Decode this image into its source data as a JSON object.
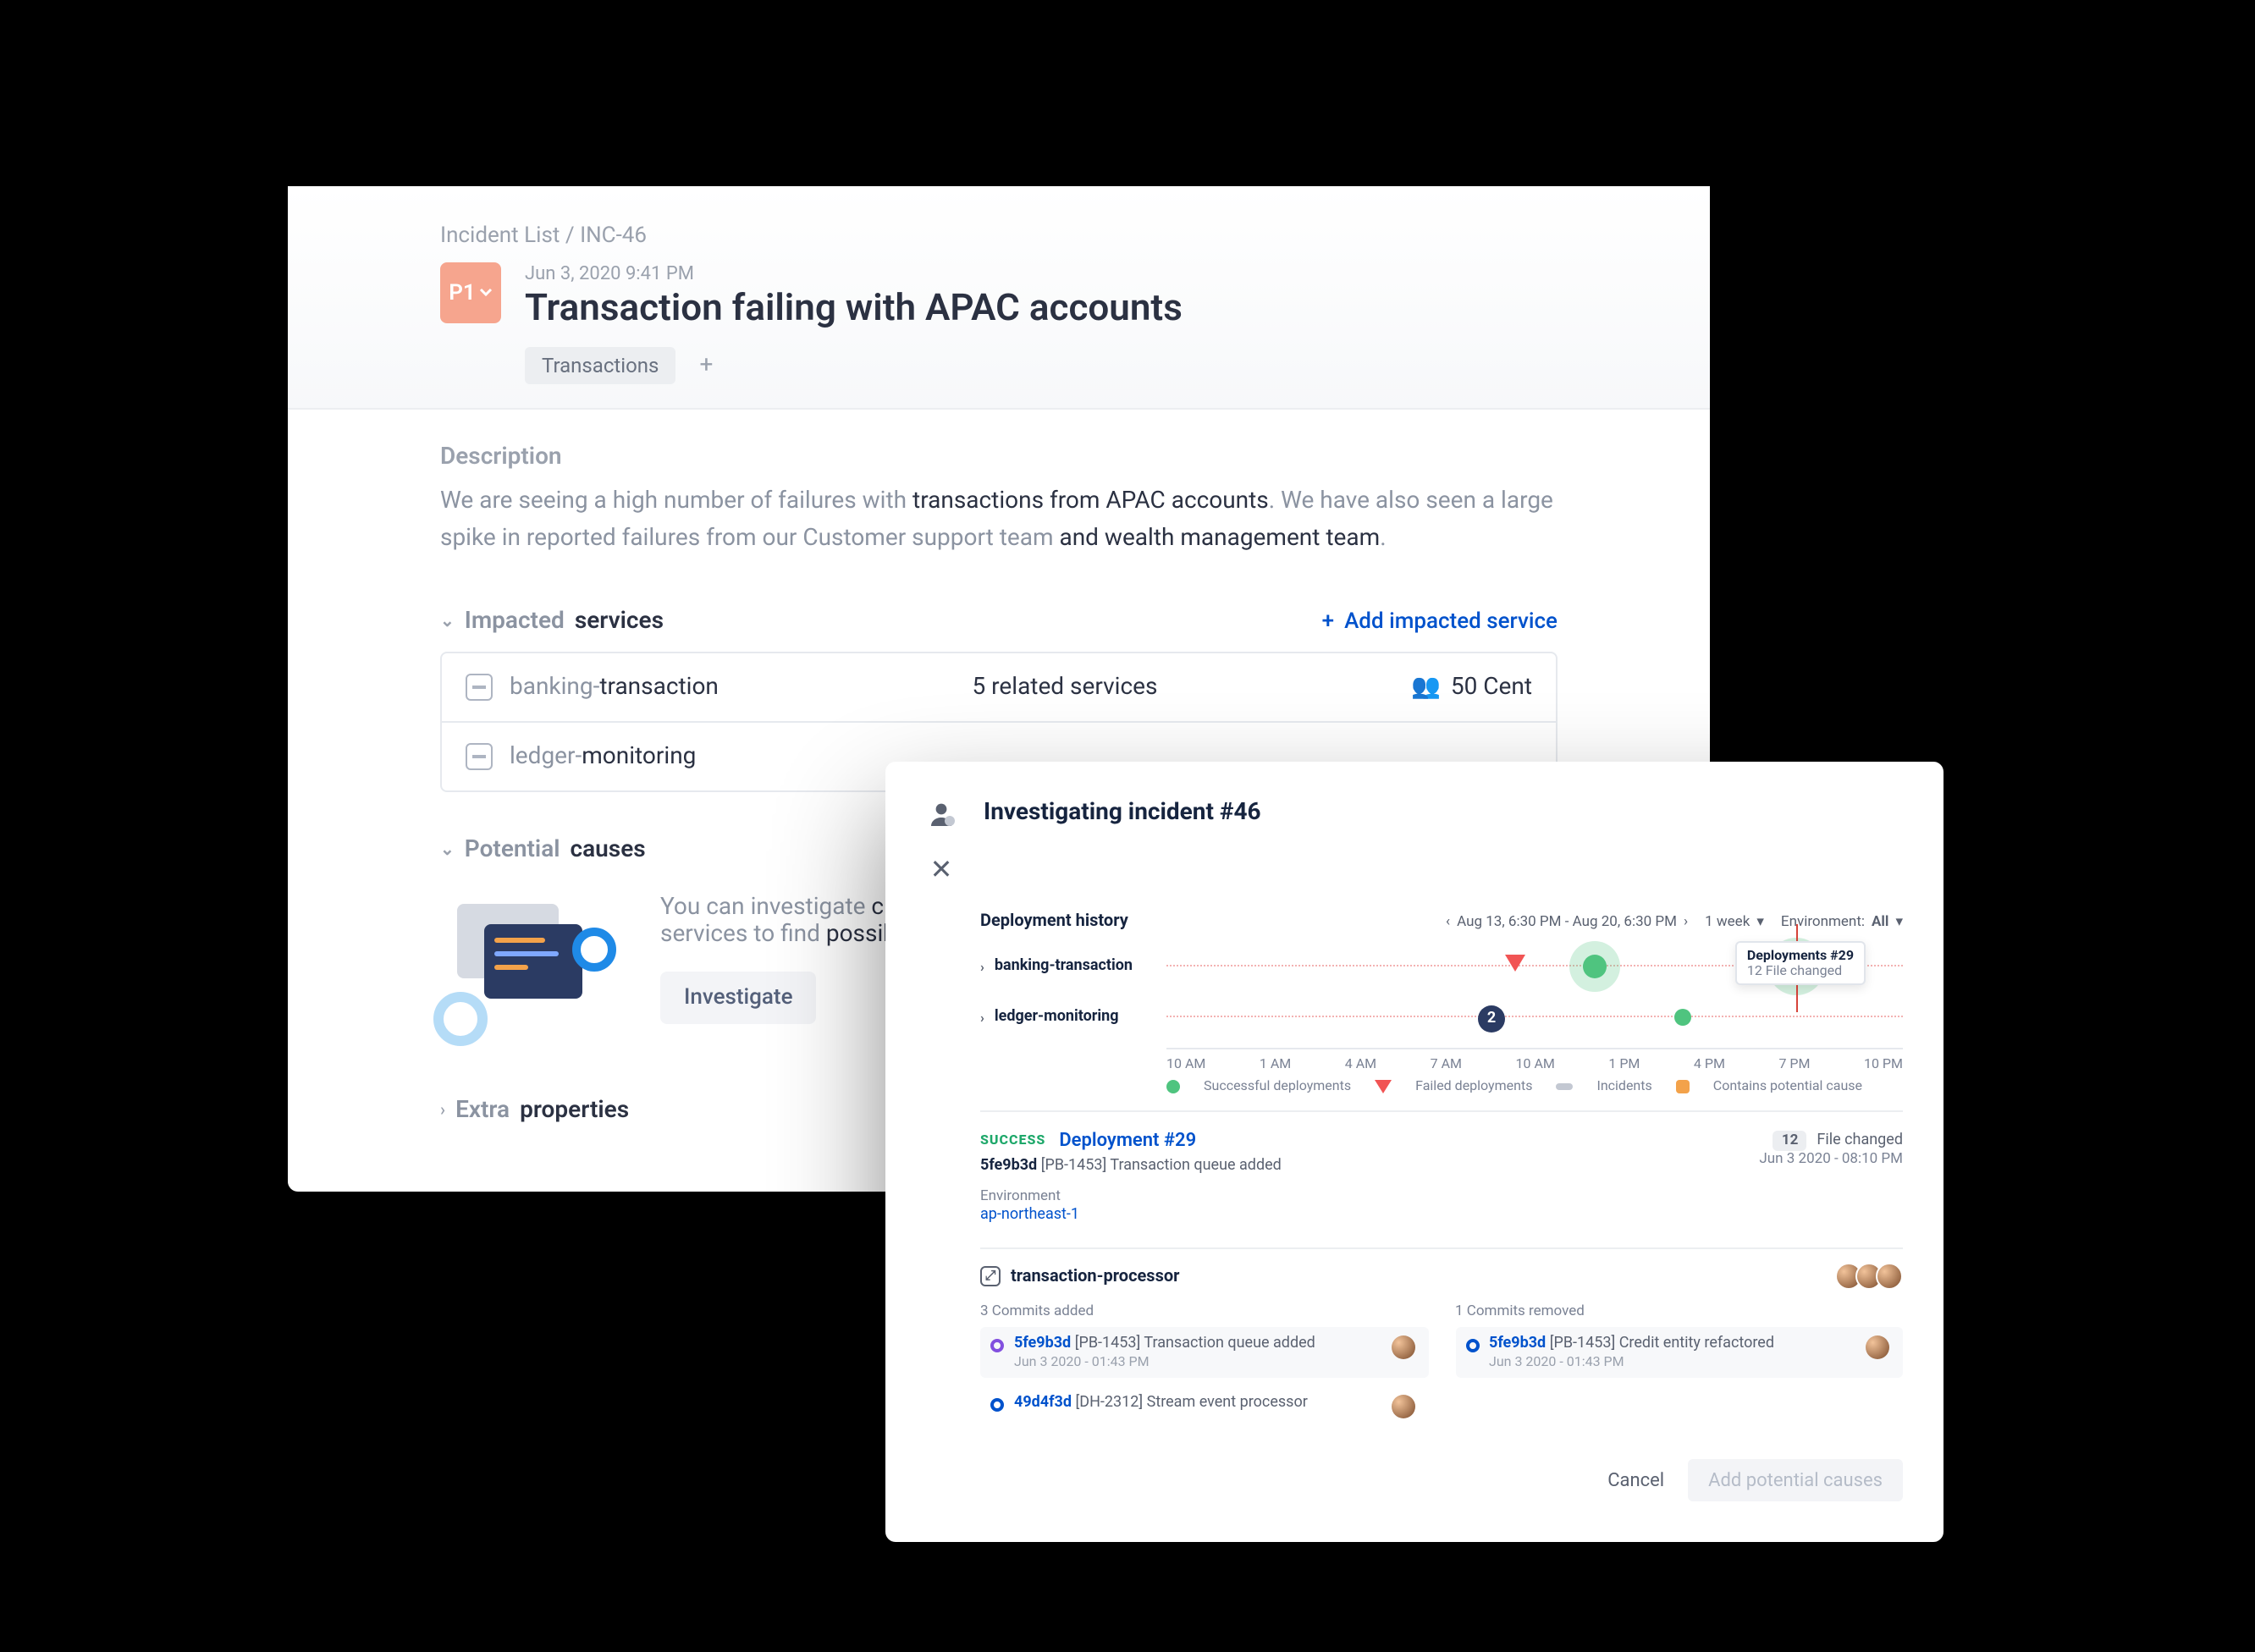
{
  "breadcrumb": {
    "list": "Incident List",
    "sep": "/",
    "id": "INC-46"
  },
  "header": {
    "priority": "P1",
    "timestamp": "Jun 3, 2020 9:41 PM",
    "title": "Transaction failing with APAC accounts",
    "tags": [
      "Transactions"
    ],
    "tag_add": "+"
  },
  "description": {
    "heading": "Description",
    "pre": "We are seeing a high number of failures with ",
    "bold1": "transactions from APAC accounts",
    "mid": ". We have also seen a large spike in reported failures from our Customer support team ",
    "bold2": "and wealth management team",
    "post": "."
  },
  "impacted": {
    "heading_pre": "Impacted ",
    "heading_bold": "services",
    "add_label": "Add impacted service",
    "row1_pre": "banking-",
    "row1_bold": "transaction",
    "row1_related": "5 related services",
    "row1_owner": "50 Cent",
    "row2_pre": "ledger-",
    "row2_bold": "monitoring"
  },
  "causes": {
    "heading_pre": "Potential ",
    "heading_bold": "causes",
    "text_pre": "You can investigate ",
    "text_bold1": "cha",
    "text_mid": " services to find ",
    "text_bold2": "possible",
    "button": "Investigate"
  },
  "extra": {
    "pre": "Extra ",
    "bold": "properties"
  },
  "investigate": {
    "title": "Investigating incident #46",
    "history_label": "Deployment history",
    "date_range": "Aug 13, 6:30 PM - Aug 20, 6:30 PM",
    "range_period": "1 week",
    "env_label": "Environment:",
    "env_val": "All",
    "rows": [
      "banking-transaction",
      "ledger-monitoring"
    ],
    "incident_badge": "2",
    "tooltip_title": "Deployments #29",
    "tooltip_sub": "12 File changed",
    "axis": [
      "10 AM",
      "1 AM",
      "4 AM",
      "7 AM",
      "10 AM",
      "1 PM",
      "4 PM",
      "7 PM",
      "10 PM"
    ],
    "legend": {
      "s": "Successful deployments",
      "f": "Failed deployments",
      "i": "Incidents",
      "p": "Contains potential cause"
    }
  },
  "deployment": {
    "status": "SUCCESS",
    "name": "Deployment #29",
    "files_badge": "12",
    "files_label": "File changed",
    "commit_hash": "5fe9b3d",
    "commit_ref": "[PB-1453]",
    "commit_msg": "Transaction queue added",
    "timestamp": "Jun 3 2020 - 08:10 PM",
    "env_label": "Environment",
    "env_value": "ap-northeast-1",
    "processor": "transaction-processor",
    "added_heading": "3 Commits added",
    "removed_heading": "1 Commits removed",
    "added": [
      {
        "hash": "5fe9b3d",
        "ref": "[PB-1453]",
        "msg": "Transaction queue added",
        "ts": "Jun 3 2020 - 01:43 PM"
      },
      {
        "hash": "49d4f3d",
        "ref": "[DH-2312]",
        "msg": "Stream event processor",
        "ts": ""
      }
    ],
    "removed": [
      {
        "hash": "5fe9b3d",
        "ref": "[PB-1453]",
        "msg": "Credit entity refactored",
        "ts": "Jun 3 2020 - 01:43 PM"
      }
    ],
    "cancel": "Cancel",
    "add_causes": "Add potential causes"
  },
  "chart_data": {
    "type": "timeline",
    "title": "Deployment history",
    "xlabel": "",
    "ylabel": "",
    "x_range": "Aug 13, 6:30 PM - Aug 20, 6:30 PM",
    "x_ticks": [
      "10 AM",
      "1 AM",
      "4 AM",
      "7 AM",
      "10 AM",
      "1 PM",
      "4 PM",
      "7 PM",
      "10 PM"
    ],
    "series": [
      {
        "name": "banking-transaction",
        "events": [
          {
            "type": "failed",
            "x": "10 AM"
          },
          {
            "type": "success",
            "x": "1 PM",
            "size": "large"
          },
          {
            "type": "success",
            "x": "8 PM",
            "size": "large",
            "highlighted": true,
            "label": "Deployments #29",
            "sublabel": "12 File changed"
          }
        ]
      },
      {
        "name": "ledger-monitoring",
        "events": [
          {
            "type": "incident",
            "x": "9 AM",
            "count": 2
          },
          {
            "type": "success",
            "x": "5 PM",
            "size": "small"
          }
        ]
      }
    ],
    "legend": [
      "Successful deployments",
      "Failed deployments",
      "Incidents",
      "Contains potential cause"
    ]
  }
}
